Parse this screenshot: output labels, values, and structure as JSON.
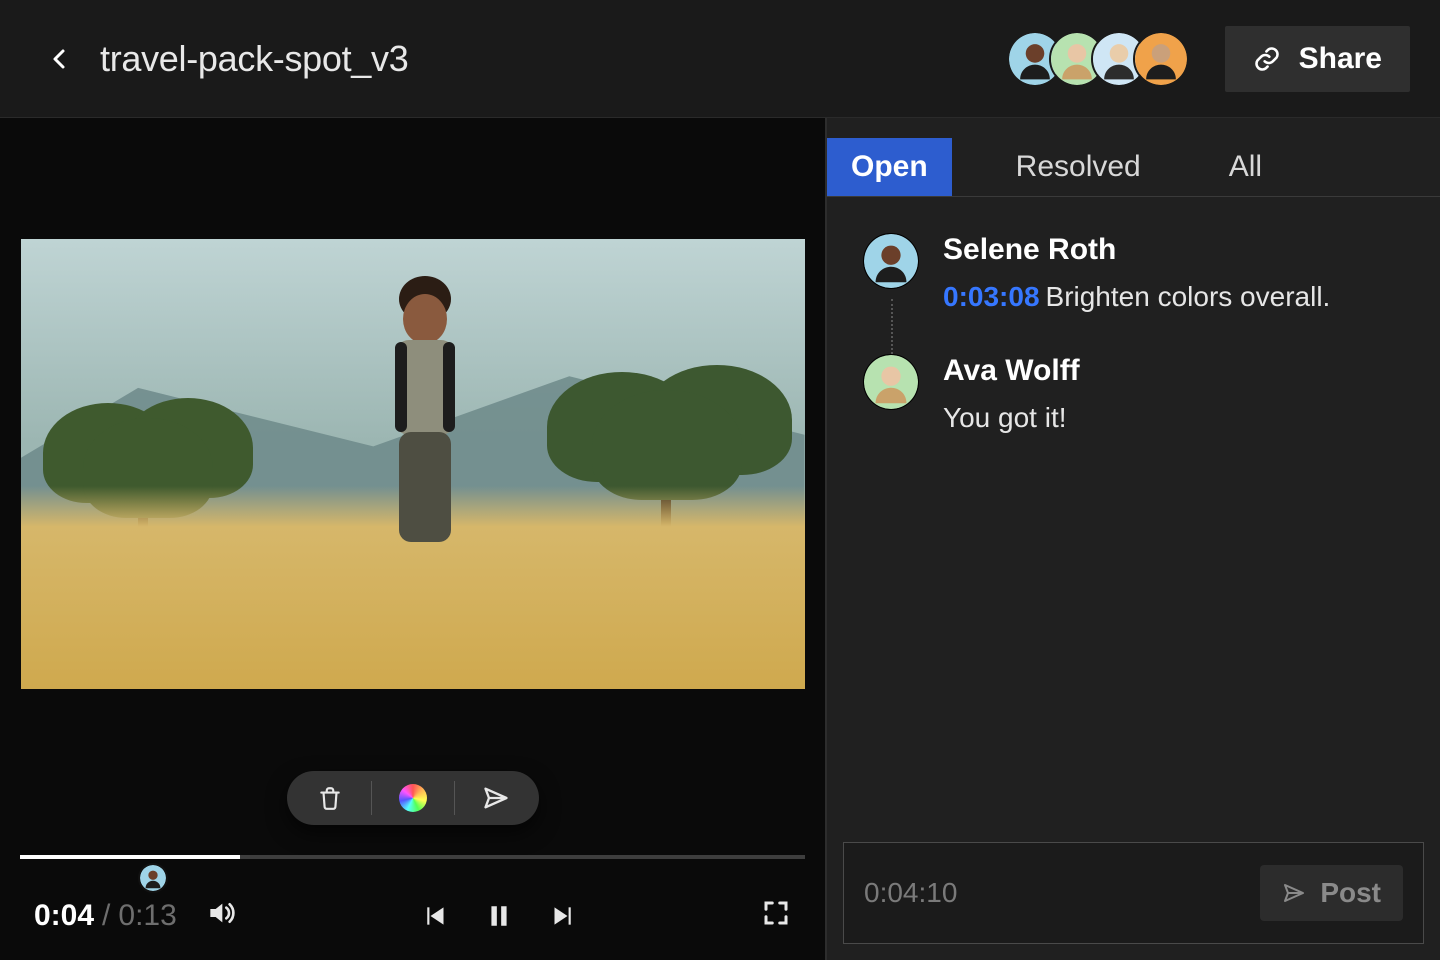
{
  "header": {
    "title": "travel-pack-spot_v3",
    "share_label": "Share",
    "collaborators": [
      {
        "bg": "#9fd4e8"
      },
      {
        "bg": "#b7e2b0"
      },
      {
        "bg": "#cfe6f5"
      },
      {
        "bg": "#f0a24a"
      }
    ]
  },
  "player": {
    "current_time": "0:04",
    "total_time": "0:13",
    "progress_percent": 28,
    "marker_percent": 17,
    "marker_avatar_bg": "#9fd4e8"
  },
  "panel": {
    "tabs": [
      {
        "label": "Open",
        "active": true
      },
      {
        "label": "Resolved",
        "active": false
      },
      {
        "label": "All",
        "active": false
      }
    ],
    "comments": [
      {
        "author": "Selene Roth",
        "avatar_bg": "#9fd4e8",
        "timestamp": "0:03:08",
        "text": "Brighten colors overall."
      },
      {
        "author": "Ava Wolff",
        "avatar_bg": "#b7e2b0",
        "timestamp": "",
        "text": "You got it!"
      }
    ],
    "compose": {
      "placeholder_timestamp": "0:04:10",
      "post_label": "Post"
    }
  }
}
